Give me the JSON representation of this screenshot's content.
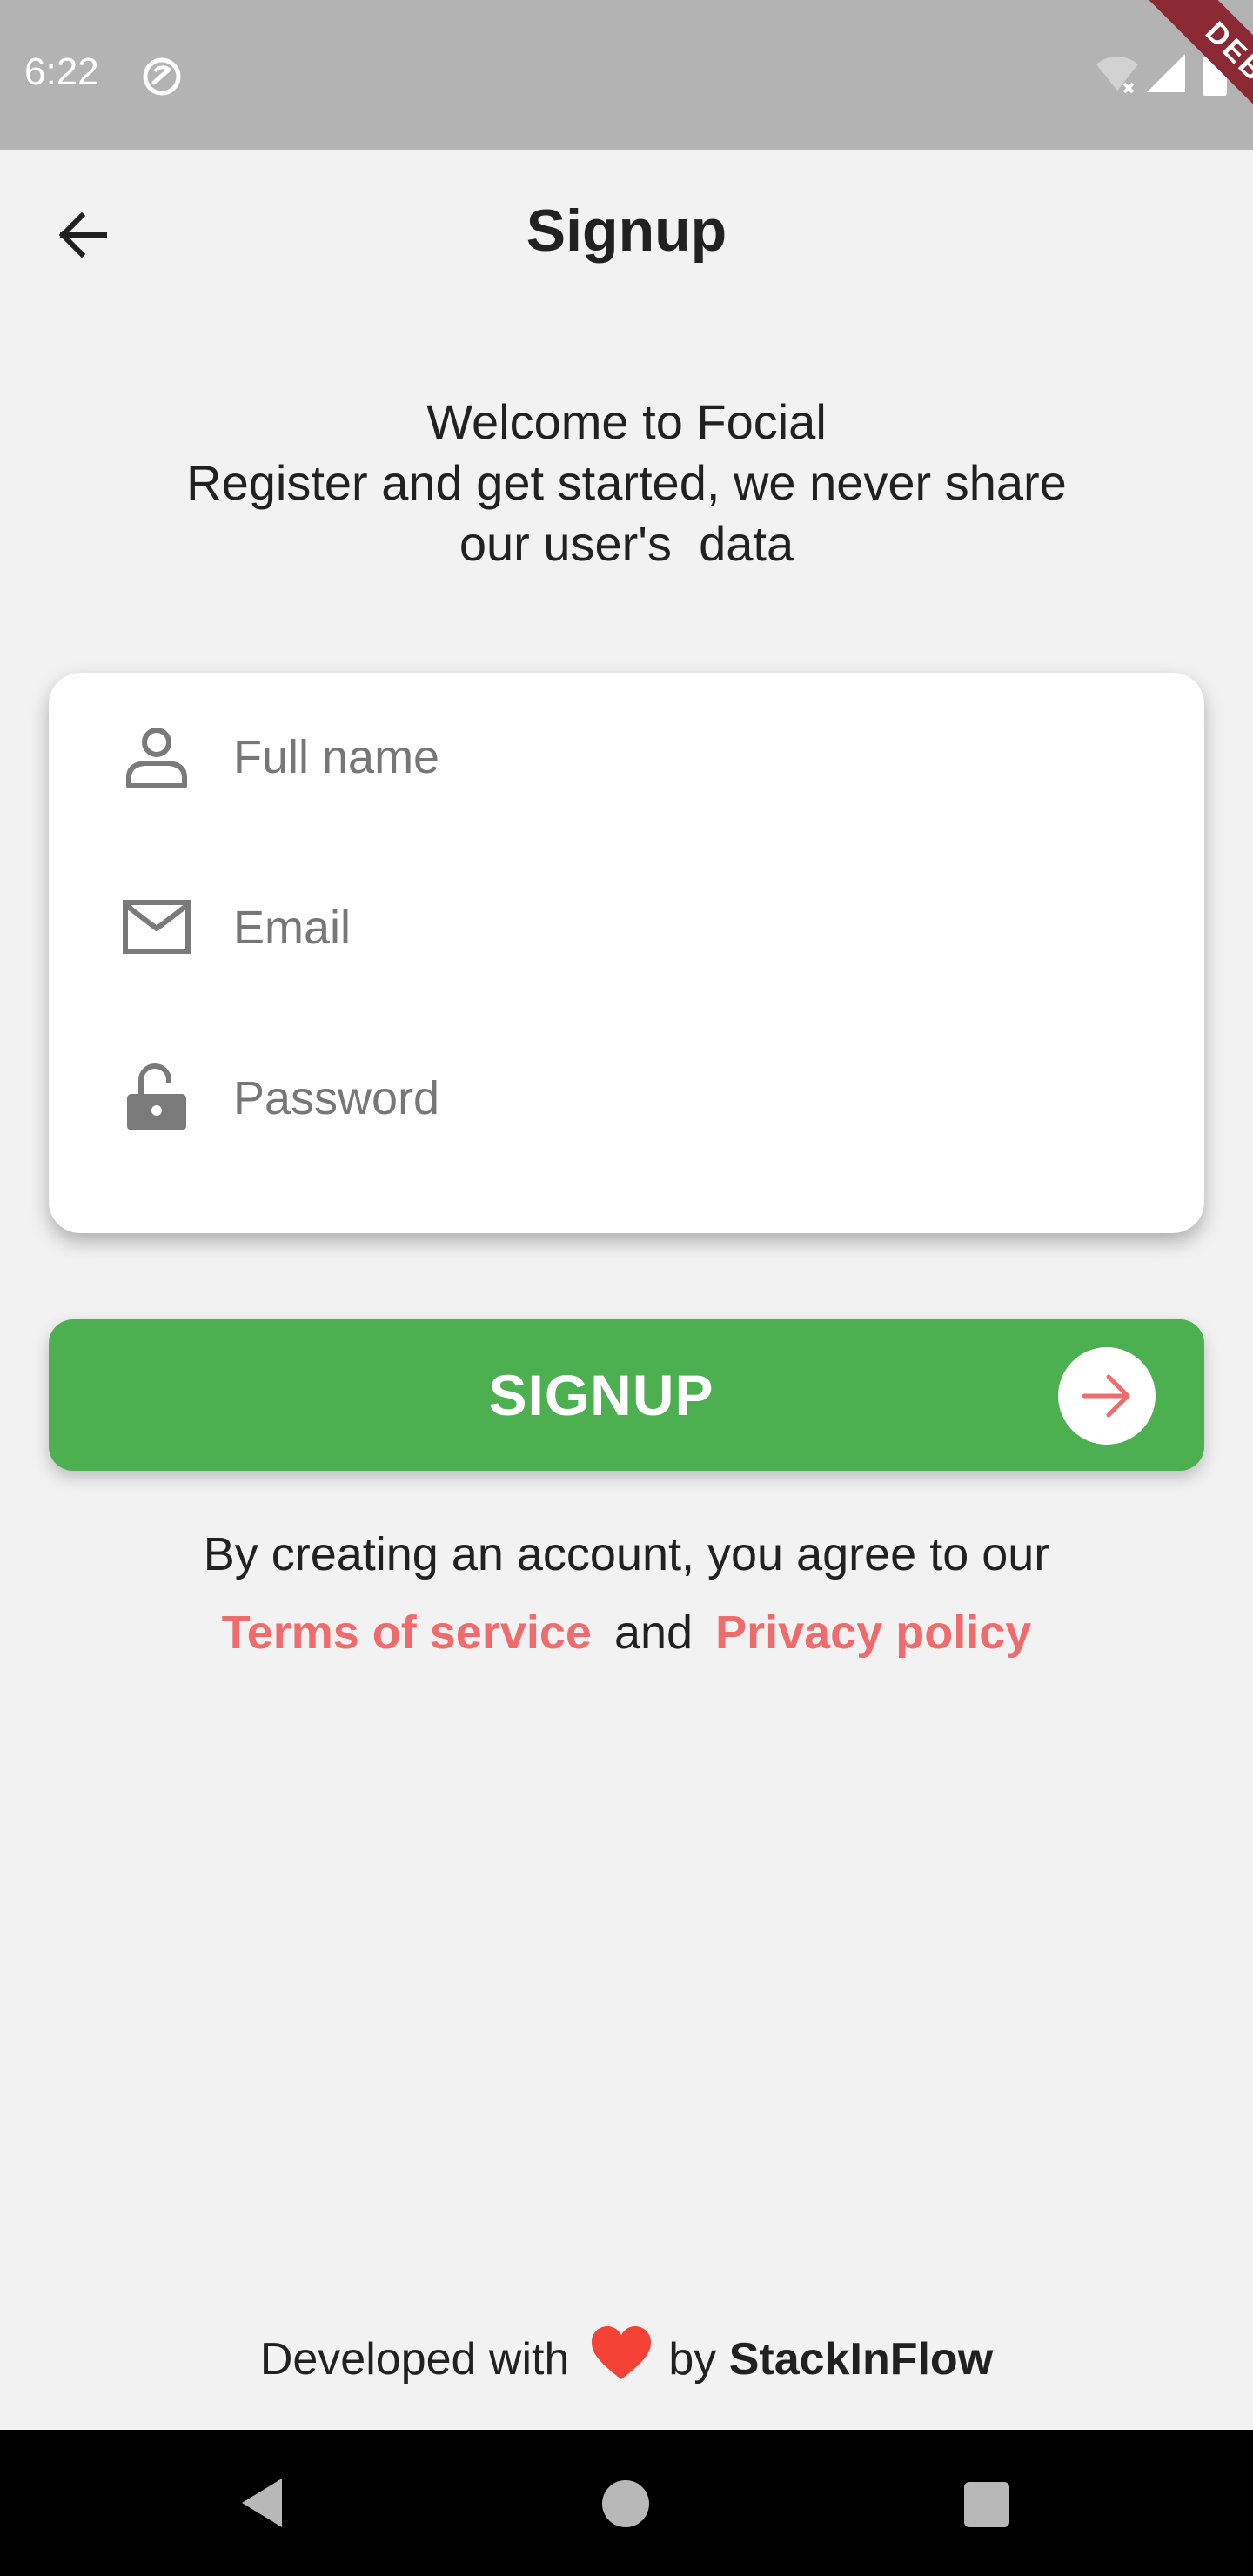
{
  "status_bar": {
    "time": "6:22",
    "debug_label": "DEBUG"
  },
  "app_bar": {
    "title": "Signup"
  },
  "welcome": {
    "line1": "Welcome to Focial",
    "line2": "Register and get started, we never share",
    "line3": "our user's  data"
  },
  "form": {
    "full_name_placeholder": "Full name",
    "email_placeholder": "Email",
    "password_placeholder": "Password"
  },
  "signup_button": {
    "label": "SIGNUP"
  },
  "agreement": {
    "text": "By creating an account, you agree to our",
    "terms_link": "Terms of service",
    "and_text": "and",
    "privacy_link": "Privacy policy"
  },
  "footer": {
    "developed_with": "Developed with",
    "by": "by",
    "brand": "StackInFlow"
  },
  "colors": {
    "primary_green": "#4caf50",
    "link_red": "#f06b6b",
    "heart_red": "#f44336",
    "background": "#f2f2f2"
  }
}
